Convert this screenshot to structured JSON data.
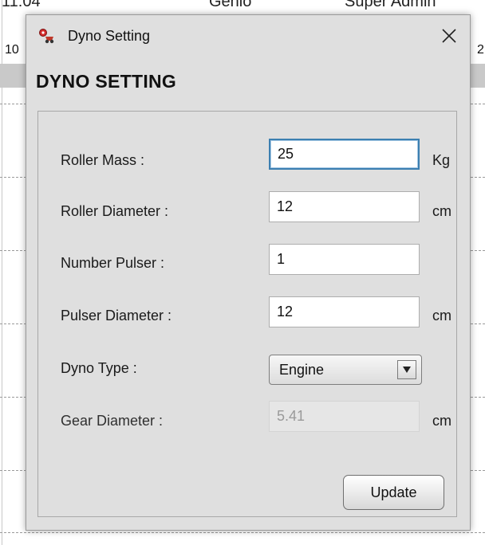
{
  "background": {
    "top_fragments": [
      "11:04",
      "Genio",
      "Super Admin"
    ],
    "left_fragment": "10",
    "right_fragment": "2"
  },
  "dialog": {
    "title": "Dyno Setting",
    "heading": "DYNO SETTING",
    "close_glyph": "✕",
    "icons": {
      "app": "dyno-app-icon",
      "close": "close-icon",
      "dropdown": "chevron-down-icon"
    },
    "fields": {
      "roller_mass": {
        "label": "Roller Mass :",
        "value": "25",
        "unit": "Kg"
      },
      "roller_diameter": {
        "label": "Roller Diameter :",
        "value": "12",
        "unit": "cm"
      },
      "number_pulser": {
        "label": "Number Pulser :",
        "value": "1"
      },
      "pulser_diameter": {
        "label": "Pulser Diameter :",
        "value": "12",
        "unit": "cm"
      },
      "dyno_type": {
        "label": "Dyno Type :",
        "value": "Engine"
      },
      "gear_diameter": {
        "label": "Gear Diameter :",
        "value": "5.41",
        "unit": "cm"
      }
    },
    "update_label": "Update"
  },
  "colors": {
    "dialog_bg": "#dfdfdf",
    "focus_border": "#3c7fb1",
    "disabled_text": "#9a9a9a"
  }
}
